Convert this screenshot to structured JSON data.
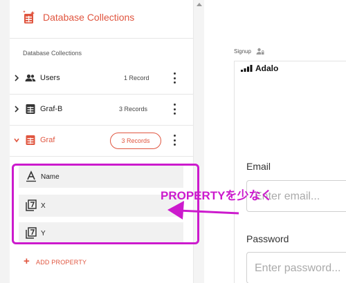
{
  "sidebar": {
    "header_title": "Database Collections",
    "section_label": "Database Collections",
    "collections": [
      {
        "label": "Users",
        "count": "1 Record",
        "icon": "users-icon",
        "chevron": "›"
      },
      {
        "label": "Graf-B",
        "count": "3 Records",
        "icon": "table-icon",
        "chevron": "›"
      },
      {
        "label": "Graf",
        "count": "3 Records",
        "icon": "table-icon",
        "chevron": "›",
        "active": true
      }
    ],
    "properties": [
      {
        "label": "Name",
        "icon": "text-type-icon"
      },
      {
        "label": "X",
        "icon": "number-type-icon"
      },
      {
        "label": "Y",
        "icon": "number-type-icon"
      }
    ],
    "add_property_label": "ADD PROPERTY"
  },
  "canvas": {
    "screen_label": "Signup",
    "status_bar_carrier": "Adalo",
    "email_label": "Email",
    "email_placeholder": "Enter email...",
    "password_label": "Password",
    "password_placeholder": "Enter password..."
  },
  "annotation": {
    "text": "PROPERTYを少なく",
    "color": "#cc1acd"
  },
  "colors": {
    "accent": "#e0553f",
    "annotation": "#cc1acd"
  }
}
